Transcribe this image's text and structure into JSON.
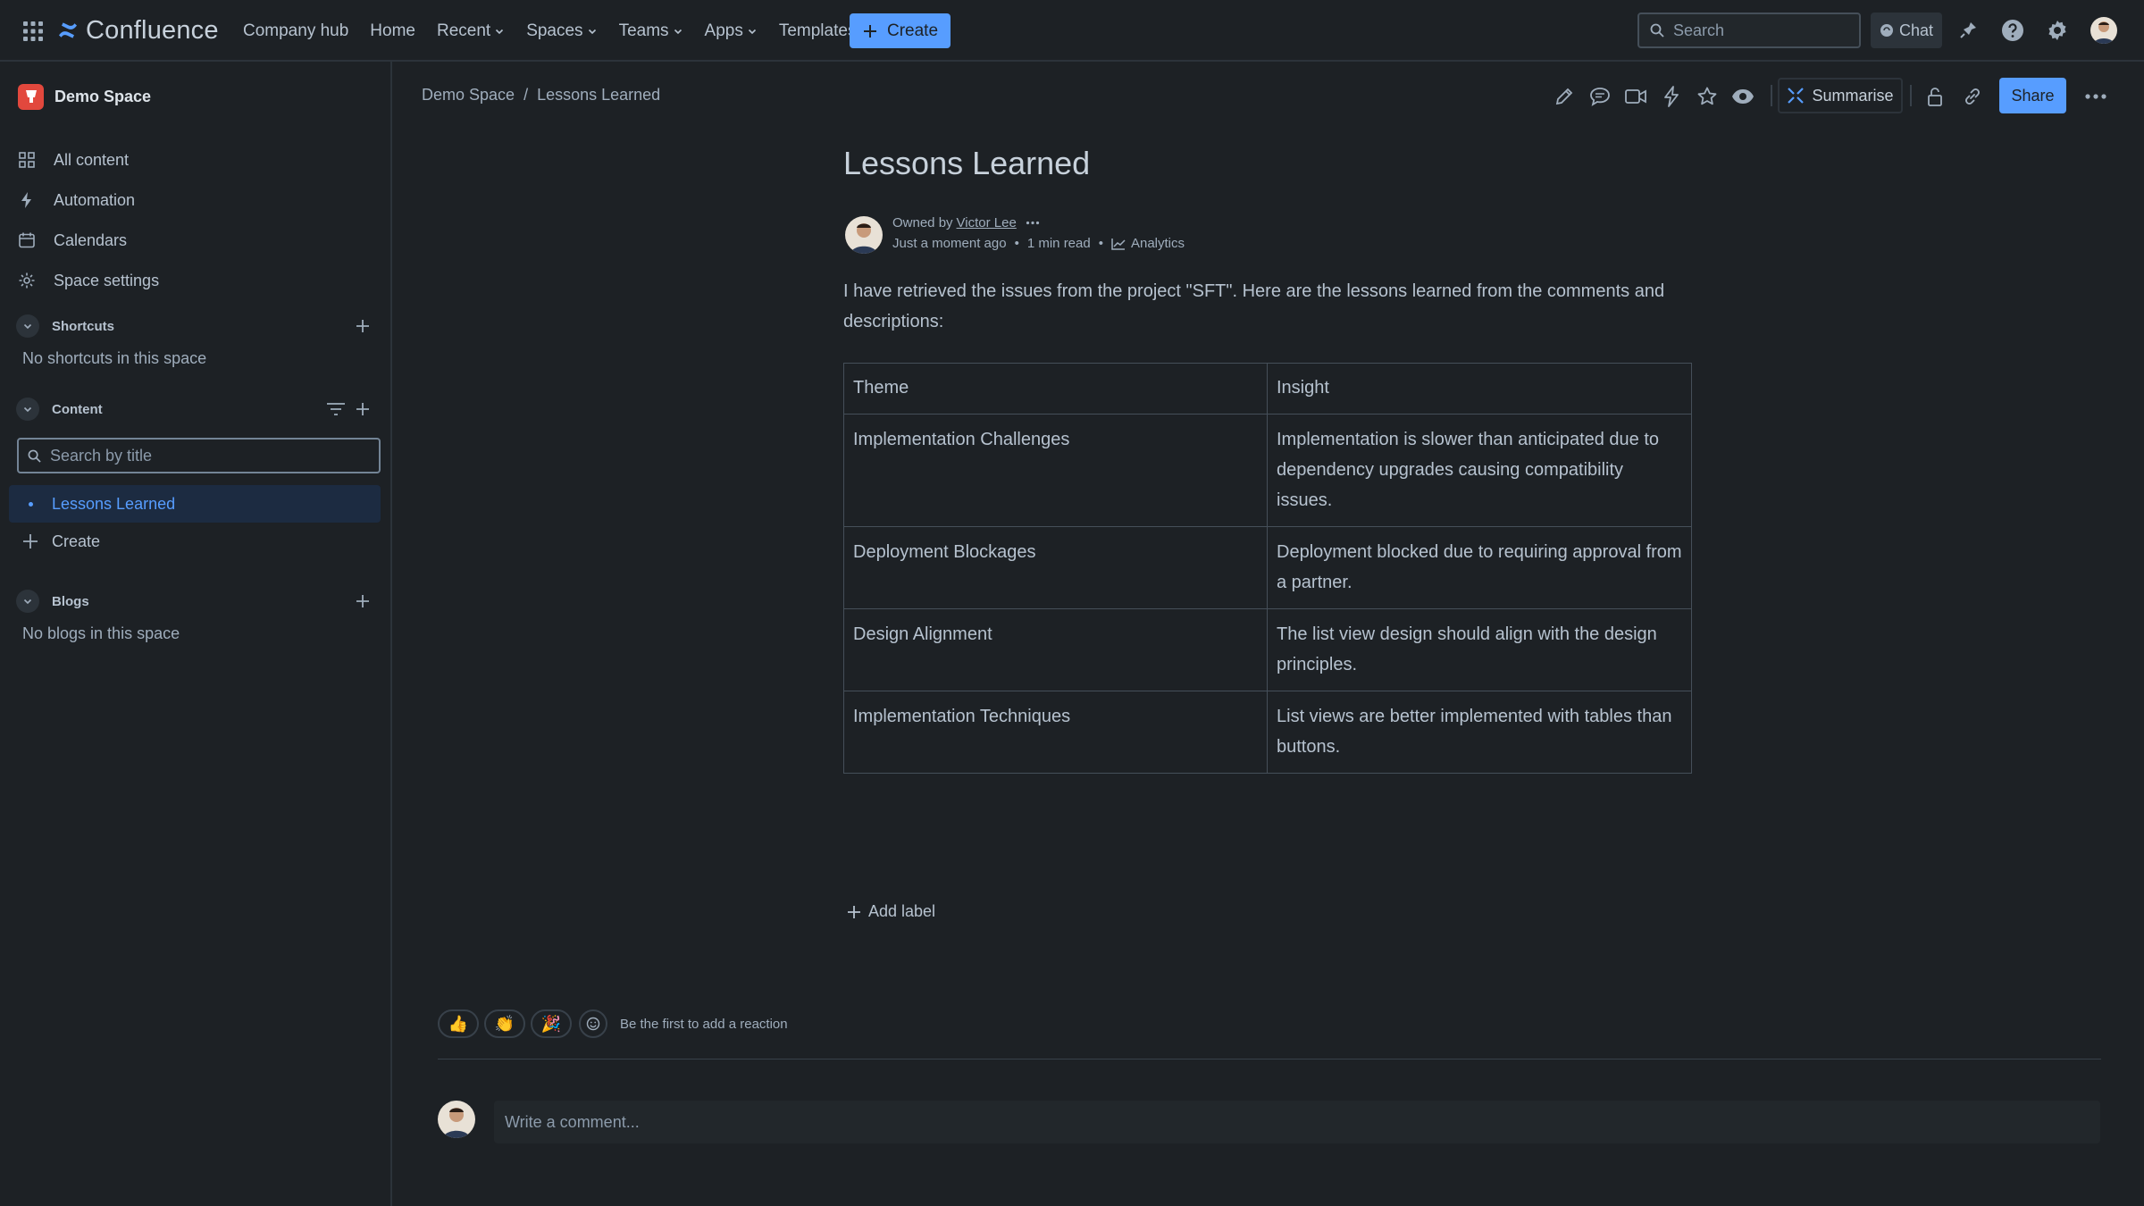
{
  "app": {
    "name": "Confluence"
  },
  "nav": {
    "items": [
      {
        "label": "Company hub"
      },
      {
        "label": "Home"
      },
      {
        "label": "Recent",
        "dropdown": true
      },
      {
        "label": "Spaces",
        "dropdown": true
      },
      {
        "label": "Teams",
        "dropdown": true
      },
      {
        "label": "Apps",
        "dropdown": true
      },
      {
        "label": "Templates"
      }
    ],
    "create_label": "Create",
    "search_placeholder": "Search",
    "chat_label": "Chat"
  },
  "sidebar": {
    "space_name": "Demo Space",
    "links": [
      {
        "label": "All content",
        "icon": "grid-icon"
      },
      {
        "label": "Automation",
        "icon": "lightning-icon"
      },
      {
        "label": "Calendars",
        "icon": "calendar-icon"
      },
      {
        "label": "Space settings",
        "icon": "gear-icon"
      }
    ],
    "shortcuts": {
      "title": "Shortcuts",
      "empty": "No shortcuts in this space"
    },
    "content": {
      "title": "Content",
      "search_placeholder": "Search by title",
      "active_item": "Lessons Learned",
      "create_label": "Create"
    },
    "blogs": {
      "title": "Blogs",
      "empty": "No blogs in this space"
    }
  },
  "breadcrumb": {
    "space": "Demo Space",
    "separator": "/",
    "page": "Lessons Learned"
  },
  "toolbar": {
    "summarise_label": "Summarise",
    "share_label": "Share"
  },
  "page": {
    "title": "Lessons Learned",
    "owned_by_prefix": "Owned by",
    "owner": "Victor Lee",
    "updated": "Just a moment ago",
    "read_time": "1 min read",
    "analytics_label": "Analytics",
    "intro": "I have retrieved the issues from the project \"SFT\". Here are the lessons learned from the comments and descriptions:",
    "table": {
      "headers": [
        "Theme",
        "Insight"
      ],
      "rows": [
        [
          "Implementation Challenges",
          "Implementation is slower than anticipated due to dependency upgrades causing compatibility issues."
        ],
        [
          "Deployment Blockages",
          "Deployment blocked due to requiring approval from a partner."
        ],
        [
          "Design Alignment",
          "The list view design should align with the design principles."
        ],
        [
          "Implementation Techniques",
          "List views are better implemented with tables than buttons."
        ]
      ]
    },
    "add_label": "Add label",
    "reactions": {
      "hint": "Be the first to add a reaction",
      "emojis": [
        "👍",
        "👏",
        "🎉"
      ]
    },
    "comment_placeholder": "Write a comment..."
  },
  "colors": {
    "accent": "#579dff",
    "background": "#1d2125",
    "text": "#b6c2cf"
  }
}
